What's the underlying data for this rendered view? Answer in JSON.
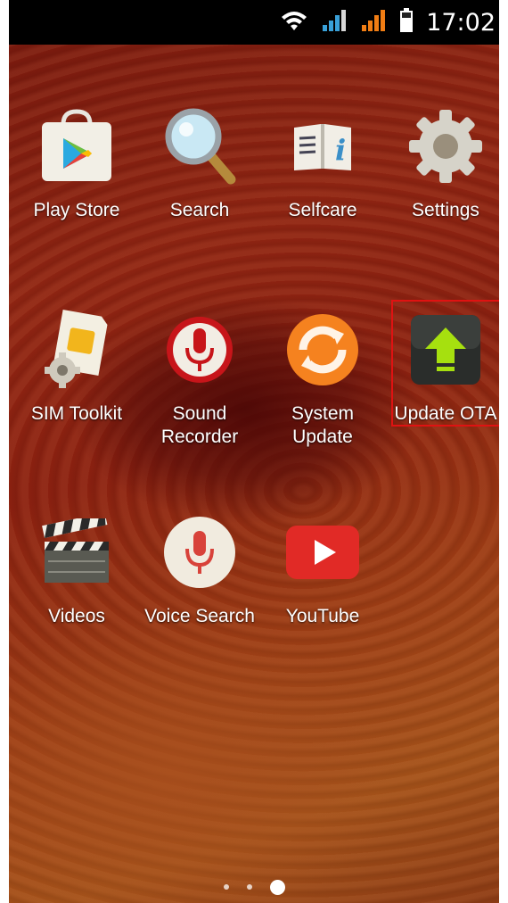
{
  "status_bar": {
    "time": "17:02",
    "icons": [
      "wifi-icon",
      "signal-icon",
      "signal-icon-sim2",
      "battery-icon"
    ]
  },
  "apps": [
    {
      "label": "Play Store",
      "icon": "play-store-icon"
    },
    {
      "label": "Search",
      "icon": "search-icon"
    },
    {
      "label": "Selfcare",
      "icon": "book-icon"
    },
    {
      "label": "Settings",
      "icon": "gear-icon"
    },
    {
      "label": "SIM Toolkit",
      "icon": "sim-card-icon"
    },
    {
      "label": "Sound Recorder",
      "icon": "microphone-icon"
    },
    {
      "label": "System Update",
      "icon": "refresh-icon"
    },
    {
      "label": "Update OTA",
      "icon": "upload-arrow-icon"
    },
    {
      "label": "Videos",
      "icon": "clapperboard-icon"
    },
    {
      "label": "Voice Search",
      "icon": "voice-mic-icon"
    },
    {
      "label": "YouTube",
      "icon": "youtube-icon"
    }
  ],
  "highlighted_app": "Update OTA",
  "page_indicator": {
    "pages": 3,
    "current": 3
  },
  "colors": {
    "highlight": "#e01212",
    "wallpaper_base": "#8e2412"
  }
}
